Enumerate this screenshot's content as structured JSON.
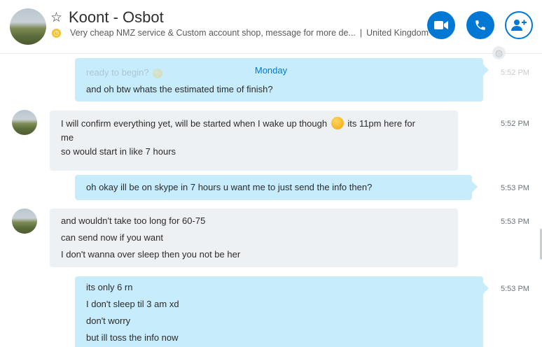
{
  "header": {
    "contact_name": "Koont - Osbot",
    "mood": "Very cheap NMZ service & Custom account shop, message for more de...",
    "separator": "|",
    "location": "United Kingdom"
  },
  "icons": {
    "favorite": "star-outline-icon",
    "video_call": "video-camera-icon",
    "audio_call": "phone-icon",
    "add_people": "add-person-icon",
    "translate": "globe-icon",
    "mood": "clock-icon"
  },
  "colors": {
    "accent": "#0078d4",
    "outgoing_bubble": "#c7edfc",
    "incoming_bubble": "#eef1f4",
    "mood_icon": "#f1c232"
  },
  "conversation": {
    "day_label": "Monday",
    "messages": [
      {
        "direction": "out",
        "lines": [
          "ready to begin?",
          "and oh btw whats the estimated time of finish?"
        ],
        "time": "5:52 PM"
      },
      {
        "direction": "in",
        "lines": [
          "I will confirm everything yet, will be started when I wake up though",
          "its 11pm here for",
          "me",
          "so would start in like 7 hours"
        ],
        "time": "5:52 PM"
      },
      {
        "direction": "out",
        "lines": [
          "oh okay ill be on skype in 7 hours u want me to just send the info then?"
        ],
        "time": "5:53 PM"
      },
      {
        "direction": "in",
        "lines": [
          "and wouldn't take too long for 60-75",
          "can send now if you want",
          "I don't wanna over sleep then you not be her"
        ],
        "time": "5:53 PM"
      },
      {
        "direction": "out",
        "lines": [
          "its only 6 rn",
          "I don't sleep til 3 am xd",
          "don't worry",
          "but ill toss the info now"
        ],
        "time": "5:53 PM"
      }
    ]
  }
}
